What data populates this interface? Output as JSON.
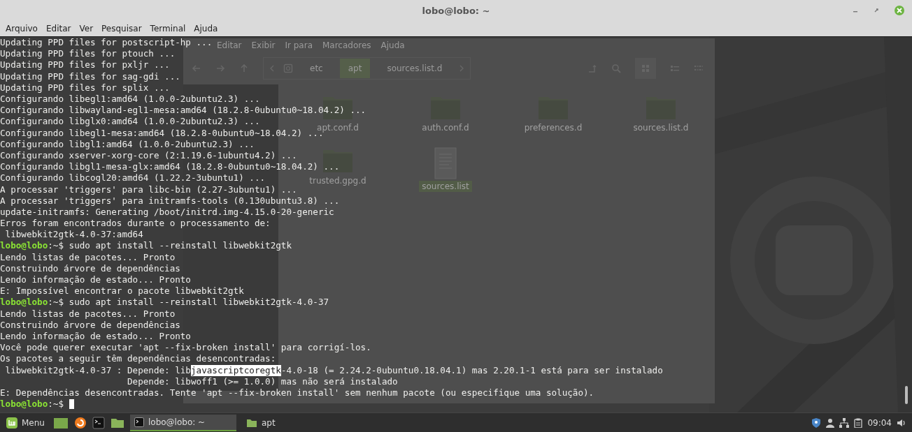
{
  "window": {
    "title": "lobo@lobo: ~"
  },
  "menu": [
    "Arquivo",
    "Editar",
    "Ver",
    "Pesquisar",
    "Terminal",
    "Ajuda"
  ],
  "background_window": {
    "menu": [
      "Editar",
      "Exibir",
      "Ir para",
      "Marcadores",
      "Ajuda"
    ],
    "path": [
      {
        "label": "etc",
        "selected": false
      },
      {
        "label": "apt",
        "selected": true
      },
      {
        "label": "sources.list.d",
        "selected": false
      }
    ],
    "files": [
      {
        "name": "apt.conf.d",
        "kind": "folder",
        "selected": false
      },
      {
        "name": "auth.conf.d",
        "kind": "folder",
        "selected": false
      },
      {
        "name": "preferences.d",
        "kind": "folder",
        "selected": false
      },
      {
        "name": "sources.list.d",
        "kind": "folder",
        "selected": false
      },
      {
        "name": "trusted.gpg.d",
        "kind": "folder",
        "selected": false
      },
      {
        "name": "sources.list",
        "kind": "file",
        "selected": true
      }
    ]
  },
  "terminal": {
    "cursor_visible": true,
    "lines": [
      {
        "parts": [
          {
            "text": "Updating PPD files for postscript-hp ...",
            "kind": "plain"
          }
        ]
      },
      {
        "parts": [
          {
            "text": "Updating PPD files for ptouch ...",
            "kind": "plain"
          }
        ]
      },
      {
        "parts": [
          {
            "text": "Updating PPD files for pxljr ...",
            "kind": "plain"
          }
        ]
      },
      {
        "parts": [
          {
            "text": "Updating PPD files for sag-gdi ...",
            "kind": "plain"
          }
        ]
      },
      {
        "parts": [
          {
            "text": "Updating PPD files for splix ...",
            "kind": "plain"
          }
        ]
      },
      {
        "parts": [
          {
            "text": "Configurando libegl1:amd64 (1.0.0-2ubuntu2.3) ...",
            "kind": "plain"
          }
        ]
      },
      {
        "parts": [
          {
            "text": "Configurando libwayland-egl1-mesa:amd64 (18.2.8-0ubuntu0~18.04.2) ...",
            "kind": "plain"
          }
        ]
      },
      {
        "parts": [
          {
            "text": "Configurando libglx0:amd64 (1.0.0-2ubuntu2.3) ...",
            "kind": "plain"
          }
        ]
      },
      {
        "parts": [
          {
            "text": "Configurando libegl1-mesa:amd64 (18.2.8-0ubuntu0~18.04.2) ...",
            "kind": "plain"
          }
        ]
      },
      {
        "parts": [
          {
            "text": "Configurando libgl1:amd64 (1.0.0-2ubuntu2.3) ...",
            "kind": "plain"
          }
        ]
      },
      {
        "parts": [
          {
            "text": "Configurando xserver-xorg-core (2:1.19.6-1ubuntu4.2) ...",
            "kind": "plain"
          }
        ]
      },
      {
        "parts": [
          {
            "text": "Configurando libgl1-mesa-glx:amd64 (18.2.8-0ubuntu0~18.04.2) ...",
            "kind": "plain"
          }
        ]
      },
      {
        "parts": [
          {
            "text": "Configurando libcogl20:amd64 (1.22.2-3ubuntu1) ...",
            "kind": "plain"
          }
        ]
      },
      {
        "parts": [
          {
            "text": "A processar 'triggers' para libc-bin (2.27-3ubuntu1) ...",
            "kind": "plain"
          }
        ]
      },
      {
        "parts": [
          {
            "text": "A processar 'triggers' para initramfs-tools (0.130ubuntu3.8) ...",
            "kind": "plain"
          }
        ]
      },
      {
        "parts": [
          {
            "text": "update-initramfs: Generating /boot/initrd.img-4.15.0-20-generic",
            "kind": "plain"
          }
        ]
      },
      {
        "parts": [
          {
            "text": "Erros foram encontrados durante o processamento de:",
            "kind": "plain"
          }
        ]
      },
      {
        "parts": [
          {
            "text": " libwebkit2gtk-4.0-37:amd64",
            "kind": "plain"
          }
        ]
      },
      {
        "parts": [
          {
            "text": "lobo@lobo",
            "kind": "prompt"
          },
          {
            "text": ":~$ sudo apt install --reinstall libwebkit2gtk",
            "kind": "plain"
          }
        ]
      },
      {
        "parts": [
          {
            "text": "Lendo listas de pacotes... Pronto",
            "kind": "plain"
          }
        ]
      },
      {
        "parts": [
          {
            "text": "Construindo árvore de dependências",
            "kind": "plain"
          }
        ]
      },
      {
        "parts": [
          {
            "text": "Lendo informação de estado... Pronto",
            "kind": "plain"
          }
        ]
      },
      {
        "parts": [
          {
            "text": "E: Impossível encontrar o pacote libwebkit2gtk",
            "kind": "plain"
          }
        ]
      },
      {
        "parts": [
          {
            "text": "lobo@lobo",
            "kind": "prompt"
          },
          {
            "text": ":~$ sudo apt install --reinstall libwebkit2gtk-4.0-37",
            "kind": "plain"
          }
        ]
      },
      {
        "parts": [
          {
            "text": "Lendo listas de pacotes... Pronto",
            "kind": "plain"
          }
        ]
      },
      {
        "parts": [
          {
            "text": "Construindo árvore de dependências",
            "kind": "plain"
          }
        ]
      },
      {
        "parts": [
          {
            "text": "Lendo informação de estado... Pronto",
            "kind": "plain"
          }
        ]
      },
      {
        "parts": [
          {
            "text": "Você pode querer executar 'apt --fix-broken install' para corrigí-los.",
            "kind": "plain"
          }
        ]
      },
      {
        "parts": [
          {
            "text": "Os pacotes a seguir têm dependências desencontradas:",
            "kind": "plain"
          }
        ]
      },
      {
        "parts": [
          {
            "text": " libwebkit2gtk-4.0-37 : Depende: lib",
            "kind": "plain"
          },
          {
            "text": "javascriptcoregtk",
            "kind": "selected"
          },
          {
            "text": "-4.0-18 (= 2.24.2-0ubuntu0.18.04.1) mas 2.20.1-1 está para ser instalado",
            "kind": "plain"
          }
        ]
      },
      {
        "parts": [
          {
            "text": "                        Depende: libwoff1 (>= 1.0.0) mas não será instalado",
            "kind": "plain"
          }
        ]
      },
      {
        "parts": [
          {
            "text": "E: Dependências desencontradas. Tente 'apt --fix-broken install' sem nenhum pacote (ou especifique uma solução).",
            "kind": "plain"
          }
        ]
      },
      {
        "parts": [
          {
            "text": "lobo@lobo",
            "kind": "prompt"
          },
          {
            "text": ":~$ ",
            "kind": "plain"
          }
        ]
      }
    ]
  },
  "taskbar": {
    "menu_label": "Menu",
    "windows": [
      {
        "label": "lobo@lobo: ~",
        "kind": "terminal",
        "selected": true
      },
      {
        "label": "apt",
        "kind": "folder",
        "selected": false
      }
    ],
    "clock": "09:04"
  }
}
